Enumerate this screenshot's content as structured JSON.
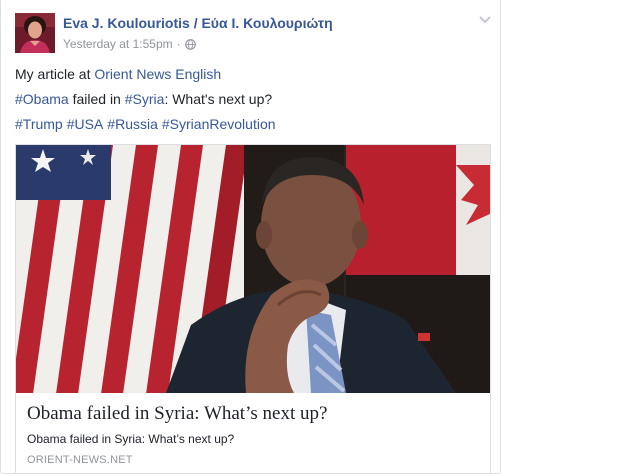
{
  "post": {
    "author": "Eva J. Koulouriotis / Εύα Ι. Κουλουριώτη",
    "timestamp": "Yesterday at 1:55pm",
    "separator": "·",
    "privacy_icon": "globe-icon",
    "options_icon": "chevron-down-icon",
    "text": {
      "line1_prefix": "My article at ",
      "line1_link": "Orient News English",
      "line2_tag1": "#Obama",
      "line2_mid": " failed in ",
      "line2_tag2": "#Syria",
      "line2_suffix": ": What's next up?",
      "hashtags": [
        "#Trump",
        "#USA",
        "#Russia",
        "#SyrianRevolution"
      ]
    }
  },
  "link_card": {
    "image_alt": "Photo of Obama with hand on chin in front of US flag",
    "title": "Obama failed in Syria: What’s next up?",
    "description": "Obama failed in Syria: What’s next up?",
    "domain": "ORIENT-NEWS.NET"
  },
  "colors": {
    "link": "#365899",
    "text": "#1d2129",
    "meta": "#90949c",
    "border": "#dddfe2"
  }
}
